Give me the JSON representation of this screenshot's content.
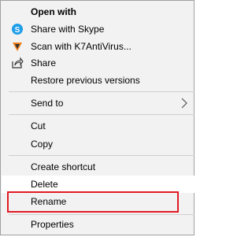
{
  "context_menu": {
    "items": {
      "open_with": "Open with",
      "share_skype": "Share with Skype",
      "scan_k7": "Scan with K7AntiVirus...",
      "share": "Share",
      "restore_versions": "Restore previous versions",
      "send_to": "Send to",
      "cut": "Cut",
      "copy": "Copy",
      "create_shortcut": "Create shortcut",
      "delete": "Delete",
      "rename": "Rename",
      "properties": "Properties"
    },
    "icons": {
      "skype": "skype-icon",
      "k7": "k7-antivirus-icon",
      "share": "share-icon",
      "submenu": "chevron-right-icon"
    },
    "colors": {
      "menu_bg": "#f2f2f2",
      "hover_bg": "#ffffff",
      "skype_blue": "#1e9ee8",
      "k7_orange": "#f07e1b",
      "annotation_red": "#e01b24"
    },
    "annotation": {
      "highlighted_item": "Rename"
    }
  }
}
